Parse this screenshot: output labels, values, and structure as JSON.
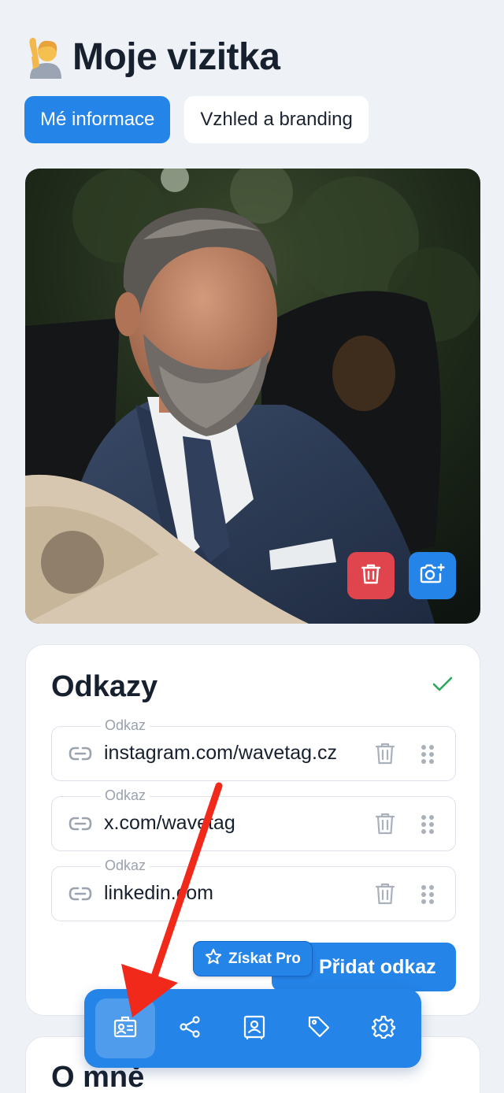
{
  "header": {
    "emoji_icon": "person-raising-hand-emoji",
    "title": "Moje vizitka"
  },
  "tabs": [
    {
      "label": "Mé informace",
      "active": true
    },
    {
      "label": "Vzhled a branding",
      "active": false
    }
  ],
  "photo": {
    "icon": "profile-photo",
    "delete_icon": "trash-icon",
    "replace_icon": "camera-plus-icon"
  },
  "links": {
    "title": "Odkazy",
    "status_icon": "check-icon",
    "items": [
      {
        "label": "Odkaz",
        "value": "instagram.com/wavetag.cz"
      },
      {
        "label": "Odkaz",
        "value": "x.com/wavetag"
      },
      {
        "label": "Odkaz",
        "value": "linkedin.com"
      }
    ],
    "add_button": "Přidat odkaz",
    "pro_badge": "Získat Pro"
  },
  "about": {
    "title": "O mně"
  },
  "bottom_nav": [
    {
      "icon": "id-card-icon",
      "active": true
    },
    {
      "icon": "share-icon",
      "active": false
    },
    {
      "icon": "contact-card-icon",
      "active": false
    },
    {
      "icon": "tag-icon",
      "active": false
    },
    {
      "icon": "gear-icon",
      "active": false
    }
  ],
  "colors": {
    "accent": "#2584e8",
    "danger": "#e0454d",
    "background": "#eef1f6",
    "annotation_arrow": "#f0291a"
  }
}
